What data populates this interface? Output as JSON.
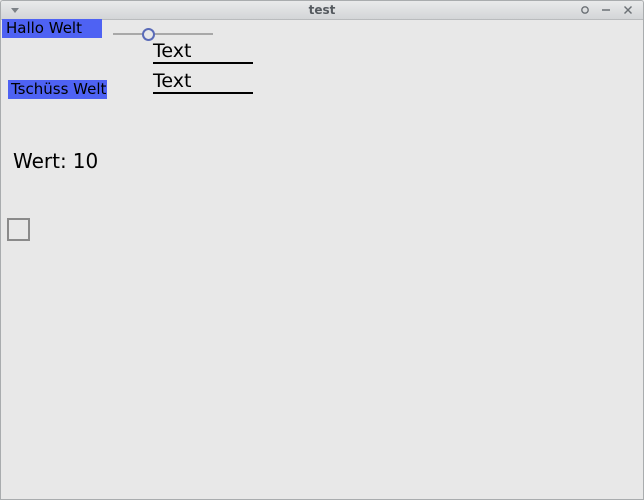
{
  "window": {
    "title": "test"
  },
  "labels": {
    "hallo": "Hallo Welt",
    "tschuess": "Tschüss Welt"
  },
  "slider": {
    "value_fraction": 0.33
  },
  "textfields": [
    {
      "value": "Text"
    },
    {
      "value": "Text"
    }
  ],
  "value_display": {
    "prefix": "Wert:",
    "value": "10"
  },
  "checkbox": {
    "checked": false
  },
  "colors": {
    "label_bg": "#4e62f3",
    "window_bg": "#e8e8e8",
    "slider_handle": "#5a6bb8"
  }
}
